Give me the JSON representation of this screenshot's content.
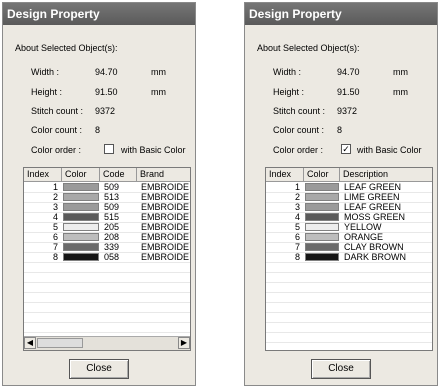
{
  "left": {
    "title": "Design Property",
    "section_label": "About Selected Object(s):",
    "width_label": "Width :",
    "width_value": "94.70",
    "width_unit": "mm",
    "height_label": "Height :",
    "height_value": "91.50",
    "height_unit": "mm",
    "stitch_label": "Stitch count :",
    "stitch_value": "9372",
    "colorcount_label": "Color count :",
    "colorcount_value": "8",
    "colororder_label": "Color order :",
    "basic_color_label": "with Basic Color",
    "basic_color_checked": false,
    "columns": [
      "Index",
      "Color",
      "Code",
      "Brand"
    ],
    "rows": [
      {
        "index": "1",
        "color": "#9a9a9a",
        "code": "509",
        "brand": "EMBROIDE"
      },
      {
        "index": "2",
        "color": "#a8a8a8",
        "code": "513",
        "brand": "EMBROIDE"
      },
      {
        "index": "3",
        "color": "#9a9a9a",
        "code": "509",
        "brand": "EMBROIDE"
      },
      {
        "index": "4",
        "color": "#5a5a5a",
        "code": "515",
        "brand": "EMBROIDE"
      },
      {
        "index": "5",
        "color": "#ededed",
        "code": "205",
        "brand": "EMBROIDE"
      },
      {
        "index": "6",
        "color": "#bdbdbd",
        "code": "208",
        "brand": "EMBROIDE"
      },
      {
        "index": "7",
        "color": "#6a6a6a",
        "code": "339",
        "brand": "EMBROIDE"
      },
      {
        "index": "8",
        "color": "#151515",
        "code": "058",
        "brand": "EMBROIDE"
      }
    ],
    "close_label": "Close"
  },
  "right": {
    "title": "Design Property",
    "section_label": "About Selected Object(s):",
    "width_label": "Width :",
    "width_value": "94.70",
    "width_unit": "mm",
    "height_label": "Height :",
    "height_value": "91.50",
    "height_unit": "mm",
    "stitch_label": "Stitch count :",
    "stitch_value": "9372",
    "colorcount_label": "Color count :",
    "colorcount_value": "8",
    "colororder_label": "Color order :",
    "basic_color_label": "with Basic Color",
    "basic_color_checked": true,
    "columns": [
      "Index",
      "Color",
      "Description"
    ],
    "rows": [
      {
        "index": "1",
        "color": "#9a9a9a",
        "description": "LEAF GREEN"
      },
      {
        "index": "2",
        "color": "#a8a8a8",
        "description": "LIME GREEN"
      },
      {
        "index": "3",
        "color": "#9a9a9a",
        "description": "LEAF GREEN"
      },
      {
        "index": "4",
        "color": "#5a5a5a",
        "description": "MOSS GREEN"
      },
      {
        "index": "5",
        "color": "#ededed",
        "description": "YELLOW"
      },
      {
        "index": "6",
        "color": "#bdbdbd",
        "description": "ORANGE"
      },
      {
        "index": "7",
        "color": "#6a6a6a",
        "description": "CLAY BROWN"
      },
      {
        "index": "8",
        "color": "#151515",
        "description": "DARK BROWN"
      }
    ],
    "close_label": "Close"
  }
}
